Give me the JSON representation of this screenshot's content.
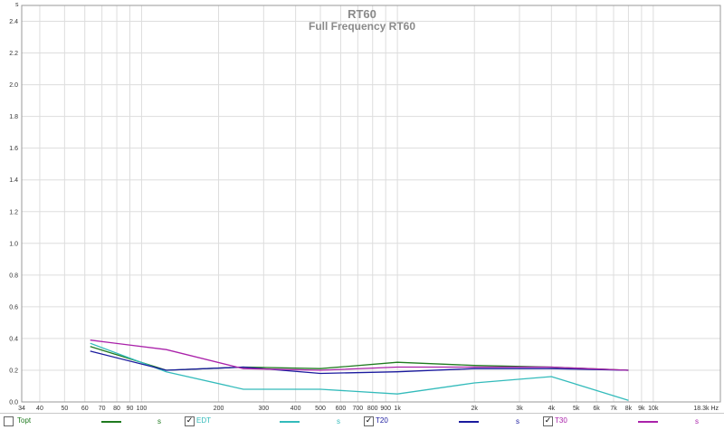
{
  "chart_data": {
    "type": "line",
    "title": "RT60",
    "subtitle": "Full Frequency RT60",
    "ylabel": "s",
    "xlabel": "Hz",
    "xscale": "log",
    "xlim": [
      34,
      18300
    ],
    "ylim": [
      0,
      2.5
    ],
    "grid": true,
    "yticks": [
      "0.0",
      "0.2",
      "0.4",
      "0.6",
      "0.8",
      "1.0",
      "1.2",
      "1.4",
      "1.6",
      "1.8",
      "2.0",
      "2.2",
      "2.4"
    ],
    "ytick_values": [
      0,
      0.2,
      0.4,
      0.6,
      0.8,
      1.0,
      1.2,
      1.4,
      1.6,
      1.8,
      2.0,
      2.2,
      2.4
    ],
    "xticks": [
      {
        "v": 34,
        "label": "34"
      },
      {
        "v": 40,
        "label": "40"
      },
      {
        "v": 50,
        "label": "50"
      },
      {
        "v": 60,
        "label": "60"
      },
      {
        "v": 70,
        "label": "70"
      },
      {
        "v": 80,
        "label": "80"
      },
      {
        "v": 90,
        "label": "90"
      },
      {
        "v": 100,
        "label": "100"
      },
      {
        "v": 200,
        "label": "200"
      },
      {
        "v": 300,
        "label": "300"
      },
      {
        "v": 400,
        "label": "400"
      },
      {
        "v": 500,
        "label": "500"
      },
      {
        "v": 600,
        "label": "600"
      },
      {
        "v": 700,
        "label": "700"
      },
      {
        "v": 800,
        "label": "800"
      },
      {
        "v": 900,
        "label": "900"
      },
      {
        "v": 1000,
        "label": "1k"
      },
      {
        "v": 2000,
        "label": "2k"
      },
      {
        "v": 3000,
        "label": "3k"
      },
      {
        "v": 4000,
        "label": "4k"
      },
      {
        "v": 5000,
        "label": "5k"
      },
      {
        "v": 6000,
        "label": "6k"
      },
      {
        "v": 7000,
        "label": "7k"
      },
      {
        "v": 8000,
        "label": "8k"
      },
      {
        "v": 9000,
        "label": "9k"
      },
      {
        "v": 10000,
        "label": "10k"
      },
      {
        "v": 18300,
        "label": "18.3k Hz"
      }
    ],
    "x": [
      63,
      125,
      250,
      500,
      1000,
      2000,
      4000,
      8000
    ],
    "series": [
      {
        "name": "Topt",
        "color": "#1f7a1f",
        "values": [
          0.35,
          0.2,
          0.22,
          0.21,
          0.25,
          0.23,
          0.22,
          0.2
        ]
      },
      {
        "name": "EDT",
        "color": "#33bbbb",
        "values": [
          0.37,
          0.19,
          0.08,
          0.08,
          0.05,
          0.12,
          0.16,
          0.01
        ]
      },
      {
        "name": "T20",
        "color": "#1a1a9e",
        "values": [
          0.32,
          0.2,
          0.22,
          0.18,
          0.19,
          0.21,
          0.21,
          0.2
        ]
      },
      {
        "name": "T30",
        "color": "#aa22aa",
        "values": [
          0.39,
          0.33,
          0.21,
          0.2,
          0.22,
          0.22,
          0.22,
          0.2
        ]
      }
    ],
    "y_axis_top_label": "s"
  },
  "legend": {
    "items": [
      {
        "label": "Topt",
        "unit": "s",
        "checked": false,
        "color": "#1f7a1f"
      },
      {
        "label": "EDT",
        "unit": "s",
        "checked": true,
        "color": "#33bbbb"
      },
      {
        "label": "T20",
        "unit": "s",
        "checked": true,
        "color": "#1a1a9e"
      },
      {
        "label": "T30",
        "unit": "s",
        "checked": true,
        "color": "#aa22aa"
      }
    ]
  }
}
